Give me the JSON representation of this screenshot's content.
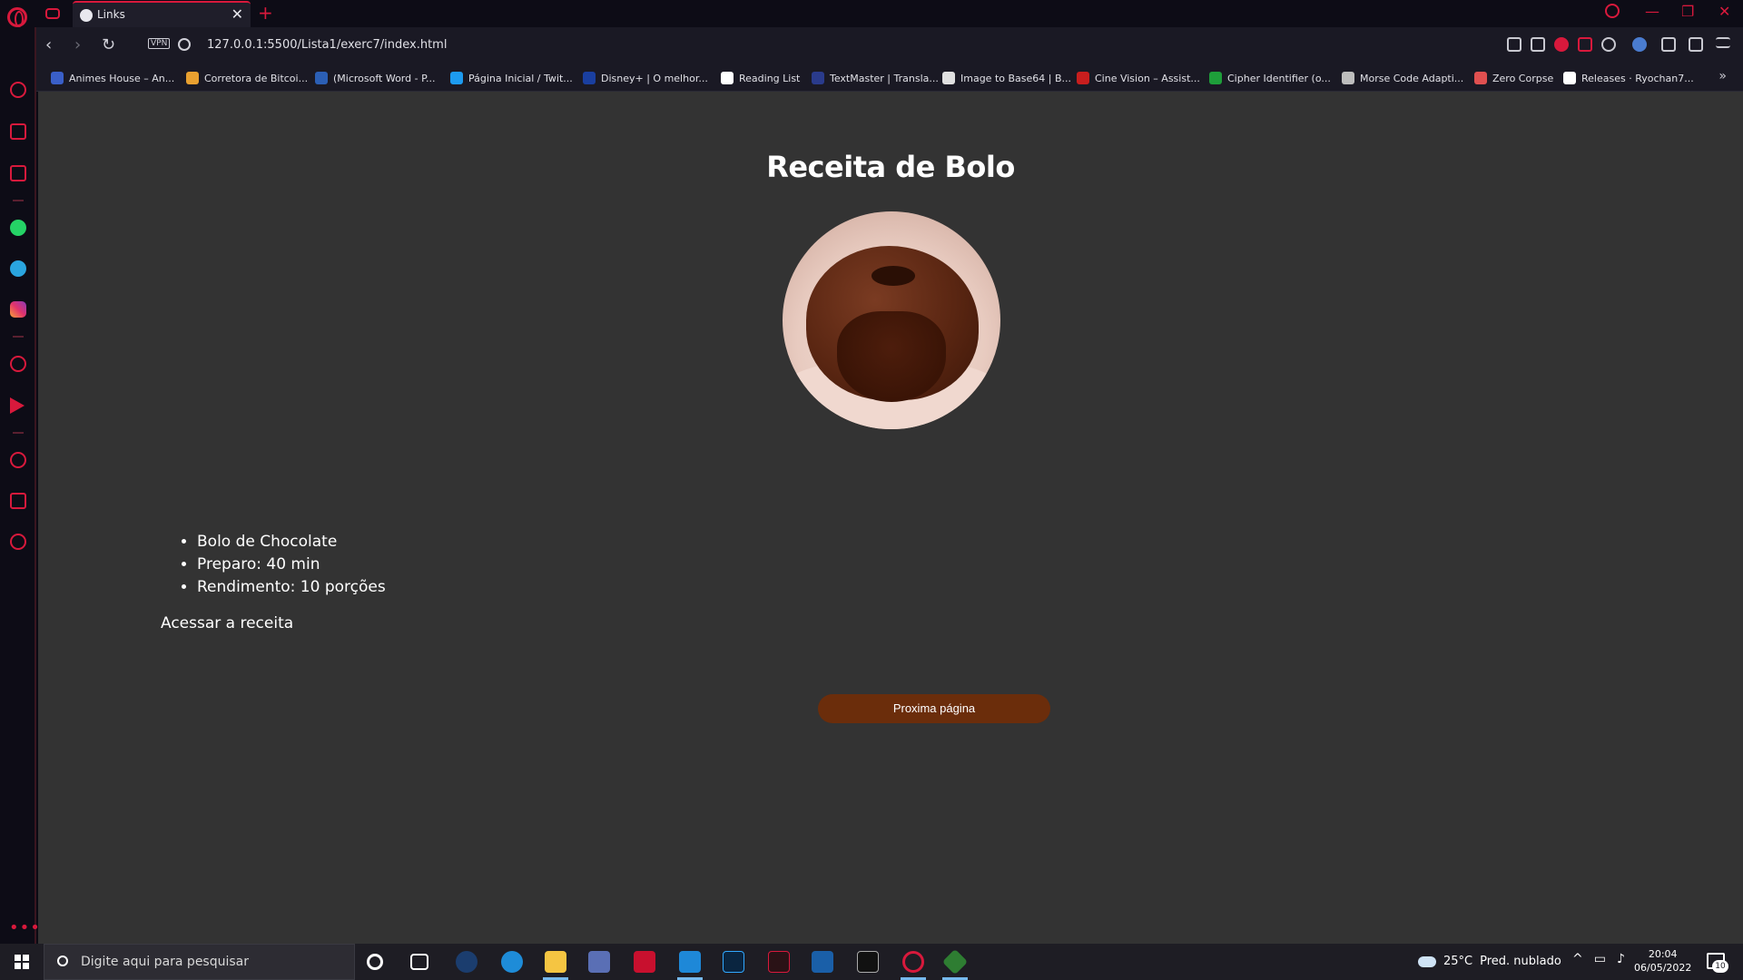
{
  "browser": {
    "tab_title": "Links",
    "url": "127.0.0.1:5500/Lista1/exerc7/index.html",
    "vpn_label": "VPN",
    "bookmarks": [
      {
        "label": "Animes House – An...",
        "color": "#3a5fc8"
      },
      {
        "label": "Corretora de Bitcoi...",
        "color": "#e8a030"
      },
      {
        "label": "(Microsoft Word - P...",
        "color": "#2b5fb5"
      },
      {
        "label": "Página Inicial / Twit...",
        "color": "#1d9bf0"
      },
      {
        "label": "Disney+ | O melhor...",
        "color": "#1a3fa0"
      },
      {
        "label": "Reading List",
        "color": "#ffffff"
      },
      {
        "label": "TextMaster | Transla...",
        "color": "#2a3b8c"
      },
      {
        "label": "Image to Base64 | B...",
        "color": "#e0e0e0"
      },
      {
        "label": "Cine Vision – Assist...",
        "color": "#c81e1e"
      },
      {
        "label": "Cipher Identifier (o...",
        "color": "#1e9e3a"
      },
      {
        "label": "Morse Code Adapti...",
        "color": "#bdbdbd"
      },
      {
        "label": "Zero Corpse",
        "color": "#e05050"
      },
      {
        "label": "Releases · Ryochan7...",
        "color": "#ffffff"
      }
    ]
  },
  "page": {
    "title": "Receita de Bolo",
    "list": [
      "Bolo de Chocolate",
      "Preparo: 40 min",
      "Rendimento: 10 porções"
    ],
    "link_text": "Acessar a receita",
    "button_label": "Proxima página"
  },
  "taskbar": {
    "search_placeholder": "Digite aqui para pesquisar",
    "weather_temp": "25°C",
    "weather_desc": "Pred. nublado",
    "time": "20:04",
    "date": "06/05/2022",
    "notification_count": "10"
  },
  "colors": {
    "accent": "#d8193c",
    "page_bg": "#333333",
    "button_bg": "#6b2d0b"
  }
}
